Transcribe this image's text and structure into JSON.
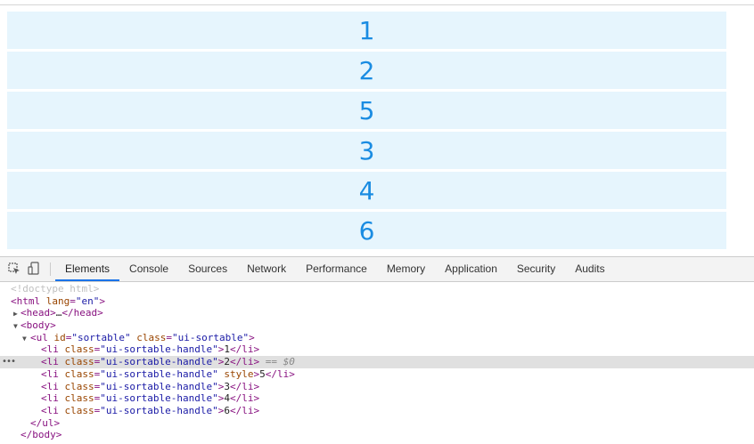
{
  "list": {
    "items": [
      "1",
      "2",
      "5",
      "3",
      "4",
      "6"
    ]
  },
  "devtools": {
    "tabs": [
      "Elements",
      "Console",
      "Sources",
      "Network",
      "Performance",
      "Memory",
      "Application",
      "Security",
      "Audits"
    ],
    "active_tab": "Elements",
    "icons": [
      "inspect-element-icon",
      "device-toolbar-icon"
    ],
    "dom": {
      "doctype": "<!doctype html>",
      "html_open": "<html",
      "lang_attr": "lang",
      "lang_value": "\"en\"",
      "head": "<head>",
      "head_ellipsis": "…",
      "head_close": "</head>",
      "body_open": "<body>",
      "ul_open": "<ul",
      "ul_id_attr": "id",
      "ul_id_value": "\"sortable\"",
      "ul_class_attr": "class",
      "ul_class_value": "\"ui-sortable\"",
      "li_open": "<li",
      "li_class_attr": "class",
      "li_class_value": "\"ui-sortable-handle\"",
      "li_style_attr": "style",
      "li_close": "</li>",
      "selected_marker": " == $0",
      "ul_close": "</ul>",
      "body_close": "</body>",
      "li_texts": [
        "1",
        "2",
        "5",
        "3",
        "4",
        "6"
      ]
    },
    "colors": {
      "accent": "#1a73e8",
      "tag": "#881280",
      "attr_name": "#994500",
      "attr_value": "#1a1aa6"
    }
  }
}
